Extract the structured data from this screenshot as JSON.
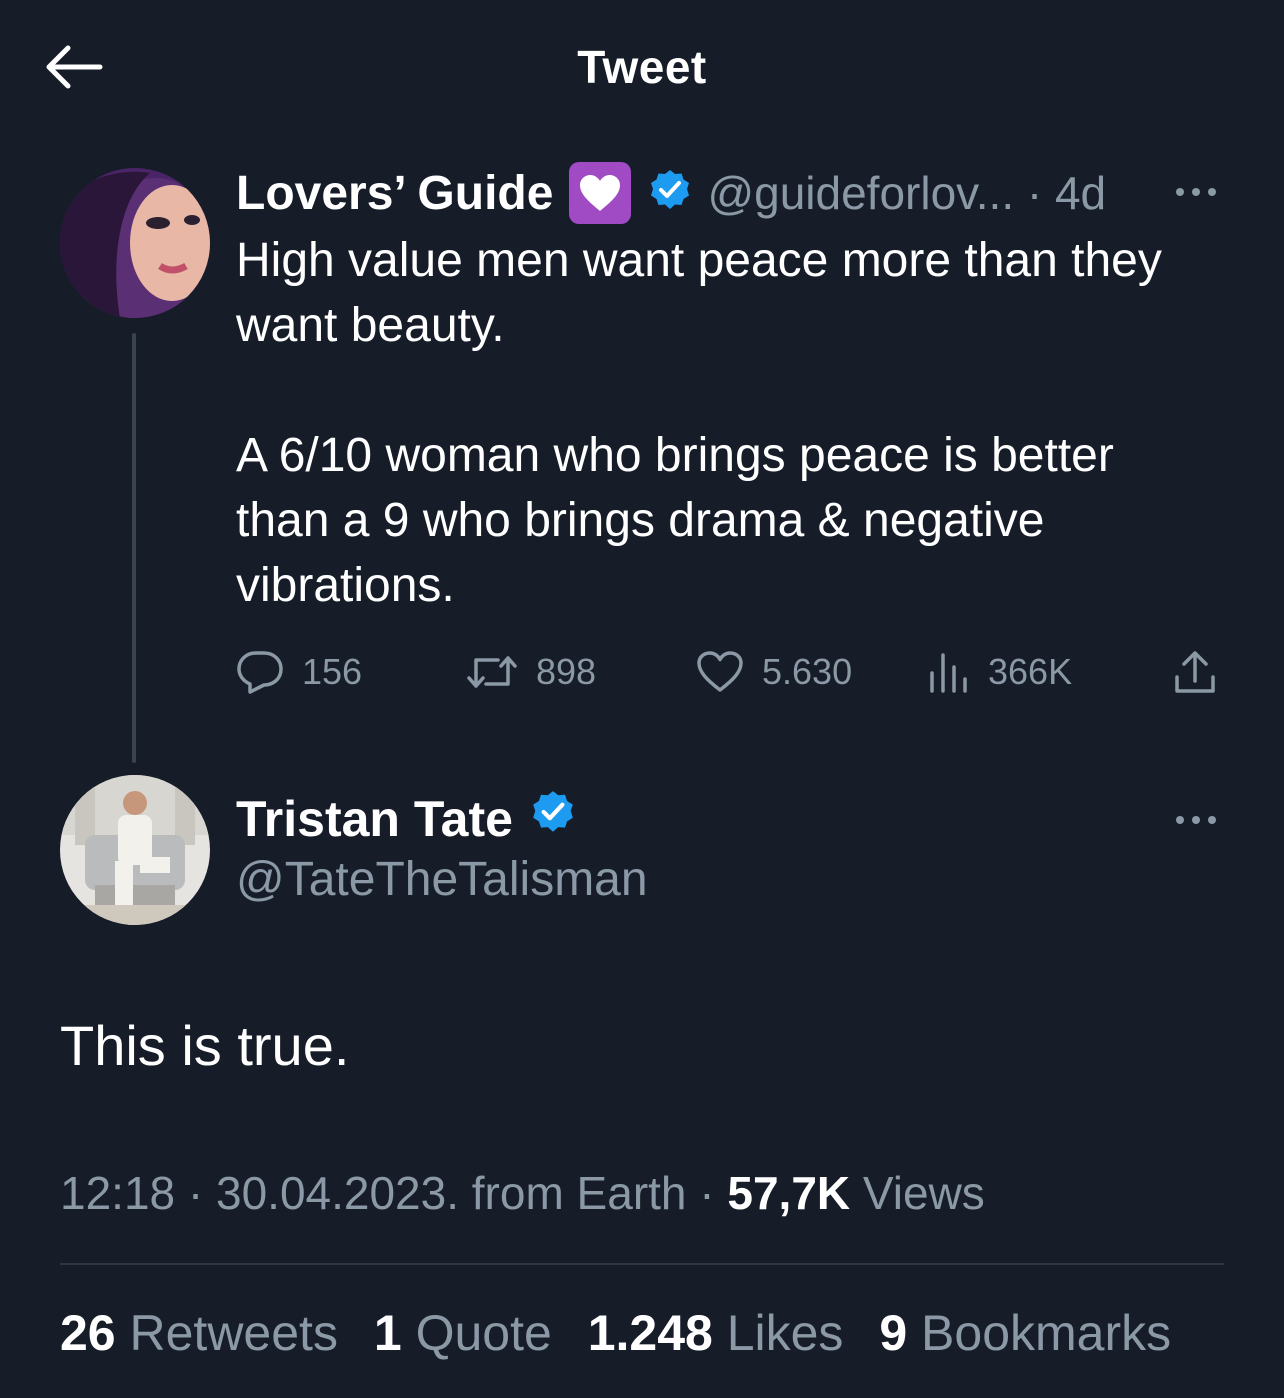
{
  "header": {
    "title": "Tweet",
    "back_icon": "arrow-left-icon"
  },
  "quoted_tweet": {
    "author_name": "Lovers’ Guide",
    "emoji": "purple-heart",
    "handle_and_time": "@guideforlov... · 4d",
    "text": "High value men want peace more than they\nwant beauty.\n\nA 6/10 woman who brings peace is better\nthan a 9 who brings drama & negative\nvibrations.",
    "actions": {
      "replies": "156",
      "retweets": "898",
      "likes": "5.630",
      "views": "366K"
    }
  },
  "tweet": {
    "author_name": "Tristan Tate",
    "handle": "@TateTheTalisman",
    "text": "This is true.",
    "meta_prefix": "12:18 · 30.04.2023. from Earth · ",
    "views_count": "57,7K",
    "views_label": " Views"
  },
  "stats": {
    "retweets_count": "26",
    "retweets_label": " Retweets",
    "quotes_count": "1",
    "quotes_label": " Quote",
    "likes_count": "1.248",
    "likes_label": " Likes",
    "bookmarks_count": "9",
    "bookmarks_label": " Bookmarks"
  },
  "colors": {
    "background": "#161d29",
    "secondary_text": "#8b98a5",
    "verified_blue": "#1d9bf0",
    "divider": "#2f3640"
  }
}
